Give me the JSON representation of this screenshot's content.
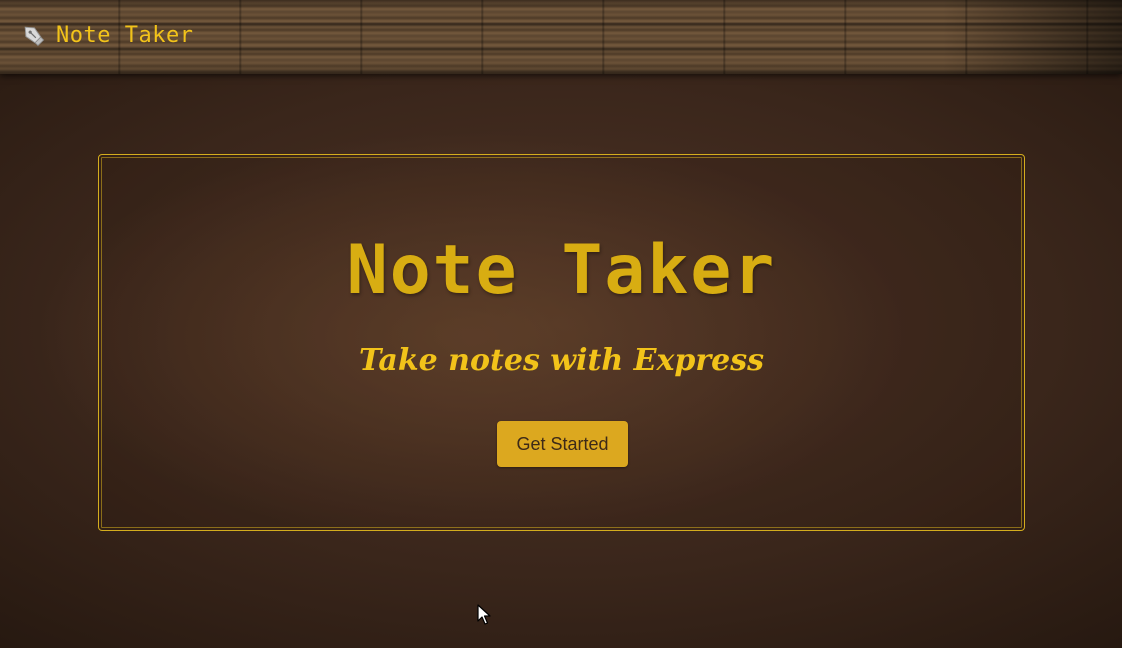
{
  "navbar": {
    "brand_icon": "pen-icon",
    "brand_label": "Note Taker"
  },
  "hero": {
    "title": "Note Taker",
    "subtitle": "Take notes with Express",
    "button_label": "Get Started"
  },
  "colors": {
    "accent": "#f2c31a",
    "title": "#d8ad12",
    "button_bg": "#dca81f",
    "button_text": "#3d2a18",
    "background": "#3a261b"
  },
  "cursor_icon": "mouse-pointer-icon"
}
